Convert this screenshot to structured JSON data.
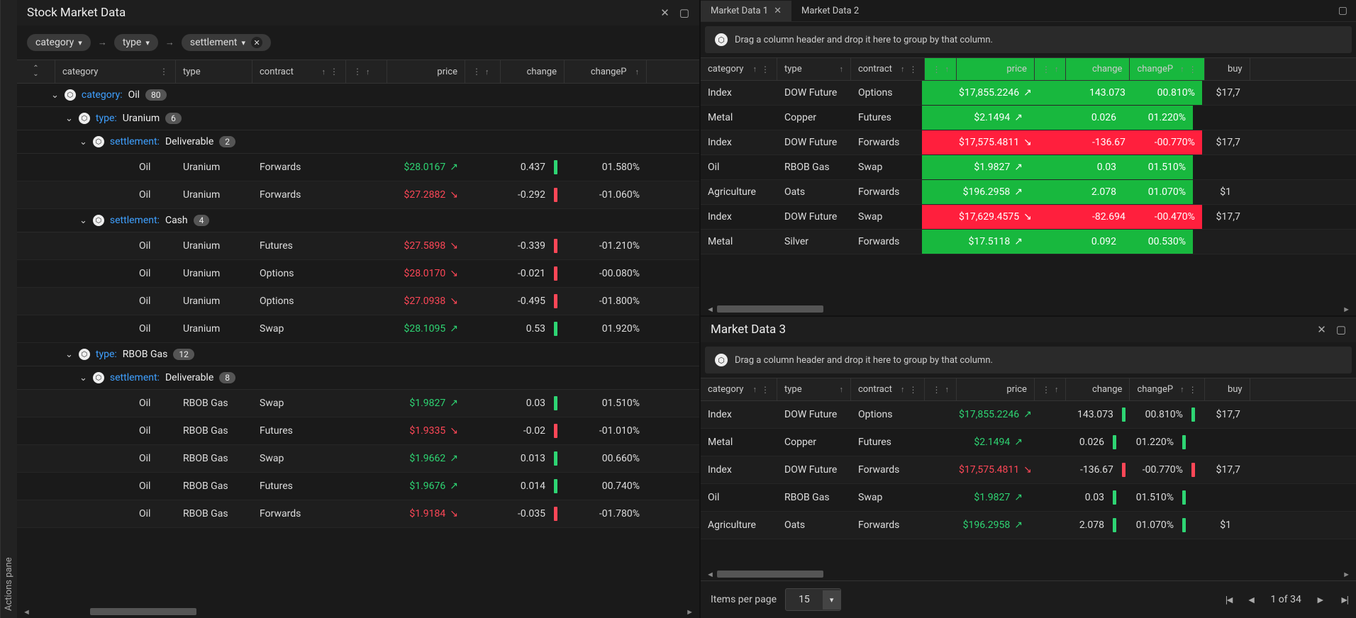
{
  "actions_pane_label": "Actions pane",
  "left": {
    "title": "Stock Market Data",
    "breadcrumb": [
      "category",
      "type",
      "settlement"
    ],
    "columns": [
      "category",
      "type",
      "contract",
      "",
      "price",
      "",
      "change",
      "changeP"
    ],
    "groups": [
      {
        "level": 0,
        "label": "category:",
        "value": "Oil",
        "count": 80
      },
      {
        "level": 1,
        "label": "type:",
        "value": "Uranium",
        "count": 6
      },
      {
        "level": 2,
        "label": "settlement:",
        "value": "Deliverable",
        "count": 2
      }
    ],
    "rows_deliverable": [
      {
        "category": "Oil",
        "type": "Uranium",
        "contract": "Forwards",
        "price": "$28.0167",
        "dir": "up",
        "change": "0.437",
        "changep": "01.580%"
      },
      {
        "category": "Oil",
        "type": "Uranium",
        "contract": "Forwards",
        "price": "$27.2882",
        "dir": "down",
        "change": "-0.292",
        "changep": "-01.060%"
      }
    ],
    "group_cash": {
      "level": 2,
      "label": "settlement:",
      "value": "Cash",
      "count": 4
    },
    "rows_cash": [
      {
        "category": "Oil",
        "type": "Uranium",
        "contract": "Futures",
        "price": "$27.5898",
        "dir": "down",
        "change": "-0.339",
        "changep": "-01.210%"
      },
      {
        "category": "Oil",
        "type": "Uranium",
        "contract": "Options",
        "price": "$28.0170",
        "dir": "down",
        "change": "-0.021",
        "changep": "-00.080%"
      },
      {
        "category": "Oil",
        "type": "Uranium",
        "contract": "Options",
        "price": "$27.0938",
        "dir": "down",
        "change": "-0.495",
        "changep": "-01.800%"
      },
      {
        "category": "Oil",
        "type": "Uranium",
        "contract": "Swap",
        "price": "$28.1095",
        "dir": "up",
        "change": "0.53",
        "changep": "01.920%"
      }
    ],
    "group_rbob": {
      "level": 1,
      "label": "type:",
      "value": "RBOB Gas",
      "count": 12
    },
    "group_rbob_deliv": {
      "level": 2,
      "label": "settlement:",
      "value": "Deliverable",
      "count": 8
    },
    "rows_rbob": [
      {
        "category": "Oil",
        "type": "RBOB Gas",
        "contract": "Swap",
        "price": "$1.9827",
        "dir": "up",
        "change": "0.03",
        "changep": "01.510%"
      },
      {
        "category": "Oil",
        "type": "RBOB Gas",
        "contract": "Futures",
        "price": "$1.9335",
        "dir": "down",
        "change": "-0.02",
        "changep": "-01.010%"
      },
      {
        "category": "Oil",
        "type": "RBOB Gas",
        "contract": "Swap",
        "price": "$1.9662",
        "dir": "up",
        "change": "0.013",
        "changep": "00.660%"
      },
      {
        "category": "Oil",
        "type": "RBOB Gas",
        "contract": "Futures",
        "price": "$1.9676",
        "dir": "up",
        "change": "0.014",
        "changep": "00.740%"
      },
      {
        "category": "Oil",
        "type": "RBOB Gas",
        "contract": "Forwards",
        "price": "$1.9184",
        "dir": "down",
        "change": "-0.035",
        "changep": "-01.780%"
      }
    ]
  },
  "right": {
    "tabs": [
      "Market Data 1",
      "Market Data 2"
    ],
    "group_hint": "Drag a column header and drop it here to group by that column.",
    "columns": [
      "category",
      "type",
      "contract",
      "",
      "price",
      "",
      "change",
      "changeP",
      "buy"
    ],
    "rows": [
      {
        "category": "Index",
        "type": "DOW Future",
        "contract": "Options",
        "price": "$17,855.2246",
        "dir": "up",
        "change": "143.073",
        "changep": "00.810%",
        "buy": "$17,7",
        "band": "green"
      },
      {
        "category": "Metal",
        "type": "Copper",
        "contract": "Futures",
        "price": "$2.1494",
        "dir": "up",
        "change": "0.026",
        "changep": "01.220%",
        "buy": "",
        "band": "green"
      },
      {
        "category": "Index",
        "type": "DOW Future",
        "contract": "Forwards",
        "price": "$17,575.4811",
        "dir": "down",
        "change": "-136.67",
        "changep": "-00.770%",
        "buy": "$17,7",
        "band": "red"
      },
      {
        "category": "Oil",
        "type": "RBOB Gas",
        "contract": "Swap",
        "price": "$1.9827",
        "dir": "up",
        "change": "0.03",
        "changep": "01.510%",
        "buy": "",
        "band": "green"
      },
      {
        "category": "Agriculture",
        "type": "Oats",
        "contract": "Forwards",
        "price": "$196.2958",
        "dir": "up",
        "change": "2.078",
        "changep": "01.070%",
        "buy": "$1",
        "band": "green"
      },
      {
        "category": "Index",
        "type": "DOW Future",
        "contract": "Swap",
        "price": "$17,629.4575",
        "dir": "down",
        "change": "-82.694",
        "changep": "-00.470%",
        "buy": "$17,7",
        "band": "red"
      },
      {
        "category": "Metal",
        "type": "Silver",
        "contract": "Forwards",
        "price": "$17.5118",
        "dir": "up",
        "change": "0.092",
        "changep": "00.530%",
        "buy": "",
        "band": "green"
      }
    ],
    "title3": "Market Data 3",
    "rows3": [
      {
        "category": "Index",
        "type": "DOW Future",
        "contract": "Options",
        "price": "$17,855.2246",
        "dir": "up",
        "change": "143.073",
        "changep": "00.810%",
        "buy": "$17,7"
      },
      {
        "category": "Metal",
        "type": "Copper",
        "contract": "Futures",
        "price": "$2.1494",
        "dir": "up",
        "change": "0.026",
        "changep": "01.220%",
        "buy": ""
      },
      {
        "category": "Index",
        "type": "DOW Future",
        "contract": "Forwards",
        "price": "$17,575.4811",
        "dir": "down",
        "change": "-136.67",
        "changep": "-00.770%",
        "buy": "$17,7"
      },
      {
        "category": "Oil",
        "type": "RBOB Gas",
        "contract": "Swap",
        "price": "$1.9827",
        "dir": "up",
        "change": "0.03",
        "changep": "01.510%",
        "buy": ""
      },
      {
        "category": "Agriculture",
        "type": "Oats",
        "contract": "Forwards",
        "price": "$196.2958",
        "dir": "up",
        "change": "2.078",
        "changep": "01.070%",
        "buy": "$1"
      }
    ],
    "pager": {
      "label": "Items per page",
      "value": "15",
      "info": "1 of 34"
    }
  }
}
